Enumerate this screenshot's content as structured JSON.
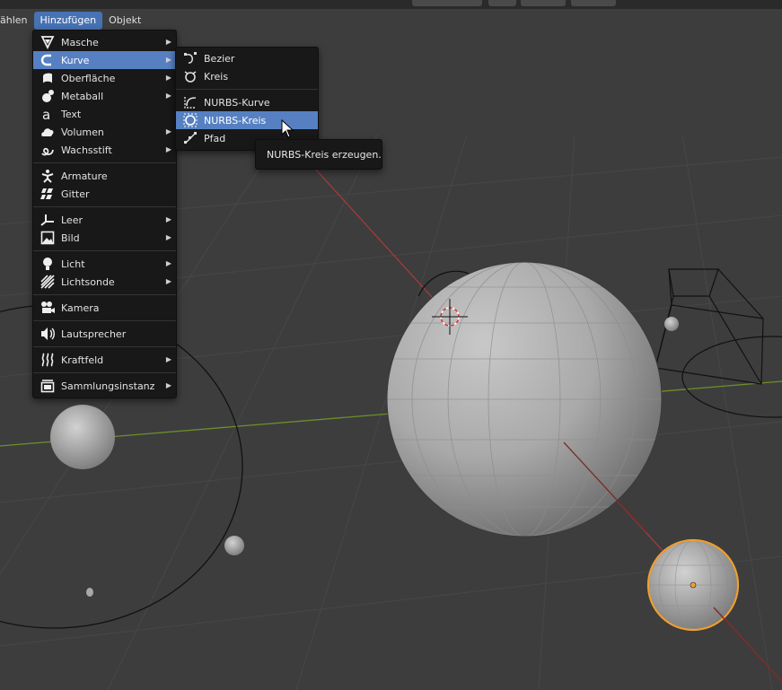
{
  "menubar": {
    "items": [
      "ählen",
      "Hinzufügen",
      "Objekt"
    ]
  },
  "add_menu": {
    "items": [
      {
        "label": "Masche",
        "icon": "mesh-icon",
        "submenu": true
      },
      {
        "label": "Kurve",
        "icon": "curve-icon",
        "submenu": true,
        "highlighted": true
      },
      {
        "label": "Oberfläche",
        "icon": "surface-icon",
        "submenu": true
      },
      {
        "label": "Metaball",
        "icon": "metaball-icon",
        "submenu": true
      },
      {
        "label": "Text",
        "icon": "text-icon",
        "submenu": false
      },
      {
        "label": "Volumen",
        "icon": "volume-icon",
        "submenu": true
      },
      {
        "label": "Wachsstift",
        "icon": "grease-pencil-icon",
        "submenu": true
      },
      {
        "label": "Armature",
        "icon": "armature-icon",
        "submenu": false
      },
      {
        "label": "Gitter",
        "icon": "lattice-icon",
        "submenu": false
      },
      {
        "label": "Leer",
        "icon": "empty-icon",
        "submenu": true
      },
      {
        "label": "Bild",
        "icon": "image-icon",
        "submenu": true
      },
      {
        "label": "Licht",
        "icon": "light-icon",
        "submenu": true
      },
      {
        "label": "Lichtsonde",
        "icon": "light-probe-icon",
        "submenu": true
      },
      {
        "label": "Kamera",
        "icon": "camera-icon",
        "submenu": false
      },
      {
        "label": "Lautsprecher",
        "icon": "speaker-icon",
        "submenu": false
      },
      {
        "label": "Kraftfeld",
        "icon": "force-field-icon",
        "submenu": true
      },
      {
        "label": "Sammlungsinstanz",
        "icon": "collection-instance-icon",
        "submenu": true
      }
    ]
  },
  "curve_submenu": {
    "items": [
      {
        "label": "Bezier",
        "icon": "bezier-curve-icon"
      },
      {
        "label": "Kreis",
        "icon": "bezier-circle-icon"
      },
      {
        "label": "NURBS-Kurve",
        "icon": "nurbs-curve-icon"
      },
      {
        "label": "NURBS-Kreis",
        "icon": "nurbs-circle-icon",
        "highlighted": true
      },
      {
        "label": "Pfad",
        "icon": "path-icon"
      }
    ]
  },
  "tooltip": {
    "text": "NURBS-Kreis erzeugen."
  },
  "colors": {
    "viewport_bg": "#3d3d3d",
    "menu_bg": "#181818",
    "highlight": "#5680c2",
    "selection_outline": "#f0a030",
    "x_axis": "#a43a3a",
    "y_axis": "#6f8e2a"
  }
}
